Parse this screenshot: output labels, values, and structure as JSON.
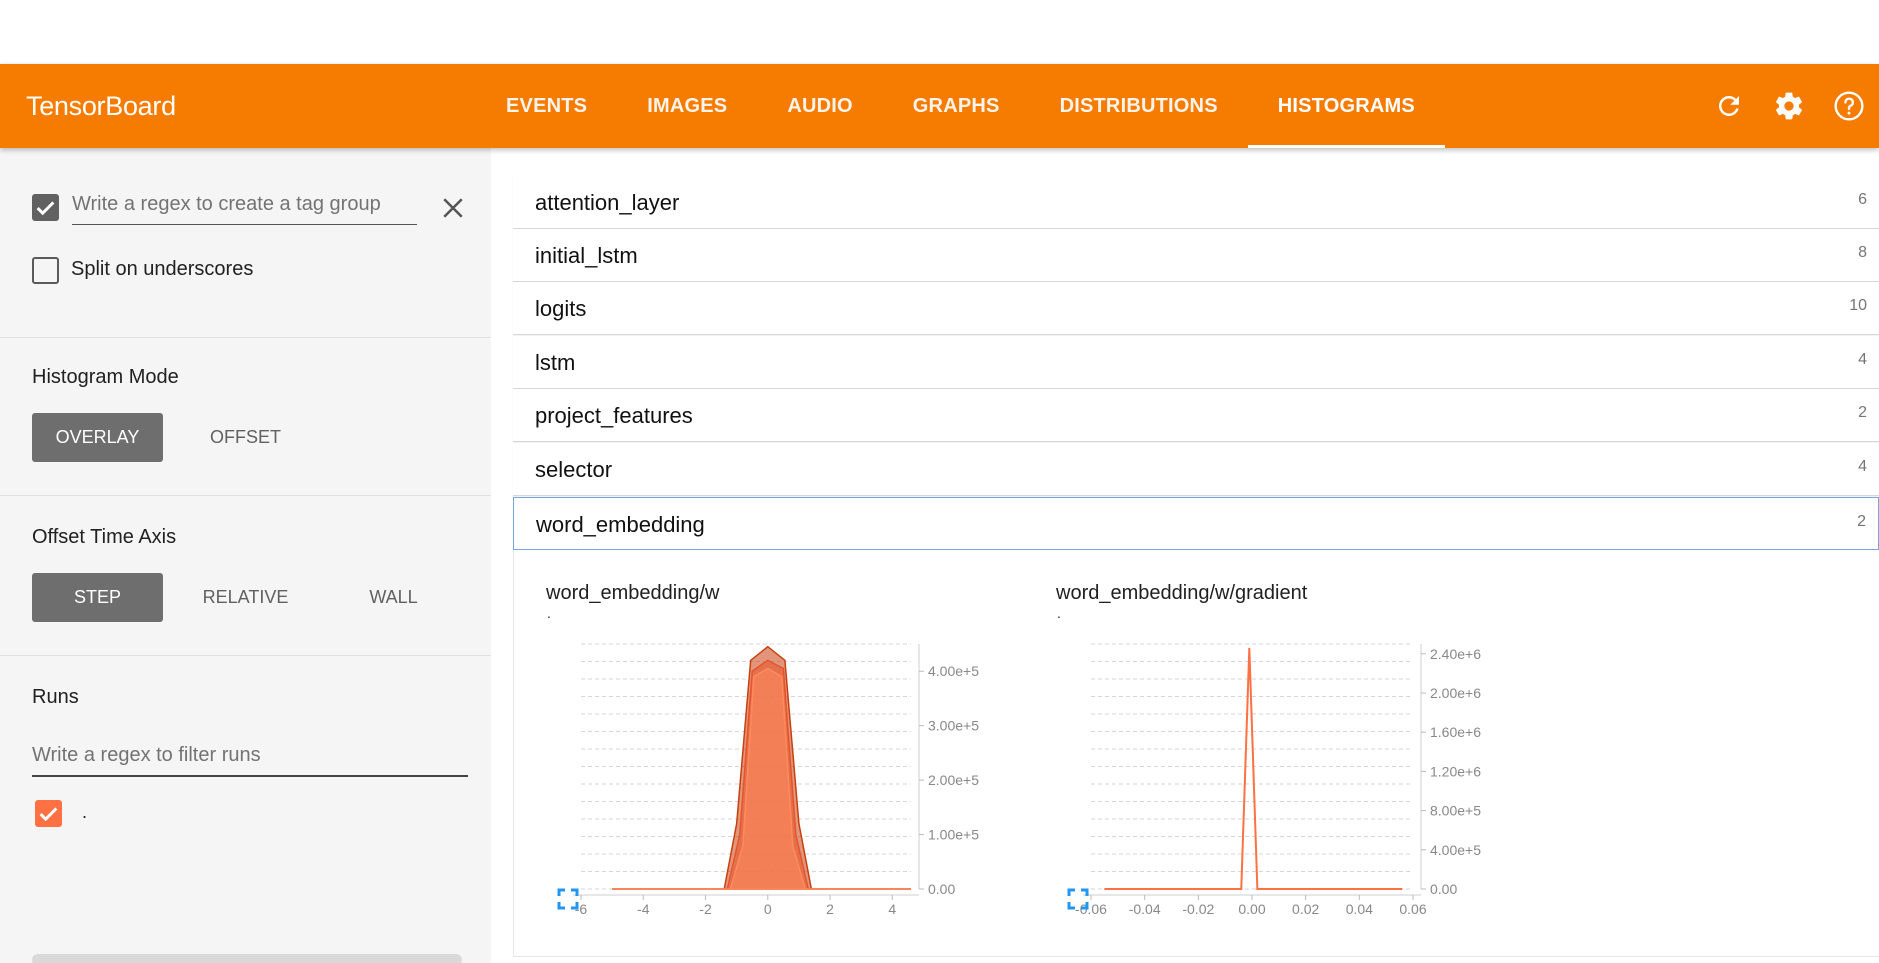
{
  "app": {
    "title": "TensorBoard",
    "tabs": [
      "EVENTS",
      "IMAGES",
      "AUDIO",
      "GRAPHS",
      "DISTRIBUTIONS",
      "HISTOGRAMS"
    ],
    "selected_tab": "HISTOGRAMS",
    "icons": [
      "refresh-icon",
      "settings-icon",
      "help-icon"
    ],
    "accent_color": "#f57c00"
  },
  "sidebar": {
    "tag_regex_checked": true,
    "tag_regex_placeholder": "Write a regex to create a tag group",
    "split_label": "Split on underscores",
    "split_checked": false,
    "histogram_mode": {
      "label": "Histogram Mode",
      "options": [
        "OVERLAY",
        "OFFSET"
      ],
      "selected": "OVERLAY"
    },
    "offset_time_axis": {
      "label": "Offset Time Axis",
      "options": [
        "STEP",
        "RELATIVE",
        "WALL"
      ],
      "selected": "STEP"
    },
    "runs": {
      "label": "Runs",
      "filter_placeholder": "Write a regex to filter runs",
      "items": [
        {
          "name": ".",
          "checked": true,
          "color": "#ff7043"
        }
      ]
    }
  },
  "categories": [
    {
      "name": "attention_layer",
      "count": "6"
    },
    {
      "name": "initial_lstm",
      "count": "8"
    },
    {
      "name": "logits",
      "count": "10"
    },
    {
      "name": "lstm",
      "count": "4"
    },
    {
      "name": "project_features",
      "count": "2"
    },
    {
      "name": "selector",
      "count": "4"
    },
    {
      "name": "word_embedding",
      "count": "2",
      "open": true
    }
  ],
  "chart_data": [
    {
      "type": "area",
      "title": "word_embedding/w",
      "run": ".",
      "series_color": "#e8542a",
      "xlim": [
        -6,
        4.6
      ],
      "ylim": [
        0,
        450000
      ],
      "x_ticks": [
        "-6",
        "-4",
        "-2",
        "0",
        "2",
        "4"
      ],
      "x_tick_values": [
        -6,
        -4,
        -2,
        0,
        2,
        4
      ],
      "y_ticks": [
        "0.00",
        "1.00e+5",
        "2.00e+5",
        "3.00e+5",
        "4.00e+5"
      ],
      "y_tick_values": [
        0,
        100000,
        200000,
        300000,
        400000
      ],
      "series": [
        {
          "x": [
            -5,
            -1.4,
            -1.0,
            -0.55,
            0,
            0.55,
            1.0,
            1.4,
            4.6
          ],
          "y": [
            0,
            0,
            120000,
            420000,
            445000,
            420000,
            120000,
            0,
            0
          ]
        },
        {
          "x": [
            -5,
            -1.3,
            -0.9,
            -0.5,
            0,
            0.5,
            0.9,
            1.3,
            4.6
          ],
          "y": [
            0,
            0,
            100000,
            400000,
            420000,
            405000,
            100000,
            0,
            0
          ]
        },
        {
          "x": [
            -5,
            -1.2,
            -0.8,
            -0.45,
            0,
            0.45,
            0.8,
            1.2,
            4.6
          ],
          "y": [
            0,
            0,
            80000,
            390000,
            405000,
            390000,
            80000,
            0,
            0
          ]
        }
      ]
    },
    {
      "type": "line",
      "title": "word_embedding/w/gradient",
      "run": ".",
      "series_color": "#ff7043",
      "xlim": [
        -0.06,
        0.06
      ],
      "ylim": [
        0,
        2500000
      ],
      "x_ticks": [
        "-0.06",
        "-0.04",
        "-0.02",
        "0.00",
        "0.02",
        "0.04",
        "0.06"
      ],
      "x_tick_values": [
        -0.06,
        -0.04,
        -0.02,
        0,
        0.02,
        0.04,
        0.06
      ],
      "y_ticks": [
        "0.00",
        "4.00e+5",
        "8.00e+5",
        "1.20e+6",
        "1.60e+6",
        "2.00e+6",
        "2.40e+6"
      ],
      "y_tick_values": [
        0,
        400000,
        800000,
        1200000,
        1600000,
        2000000,
        2400000
      ],
      "series": [
        {
          "x": [
            -0.055,
            -0.004,
            -0.001,
            0.002,
            0.005,
            0.056
          ],
          "y": [
            0,
            0,
            2460000,
            0,
            0,
            0
          ]
        }
      ]
    }
  ]
}
